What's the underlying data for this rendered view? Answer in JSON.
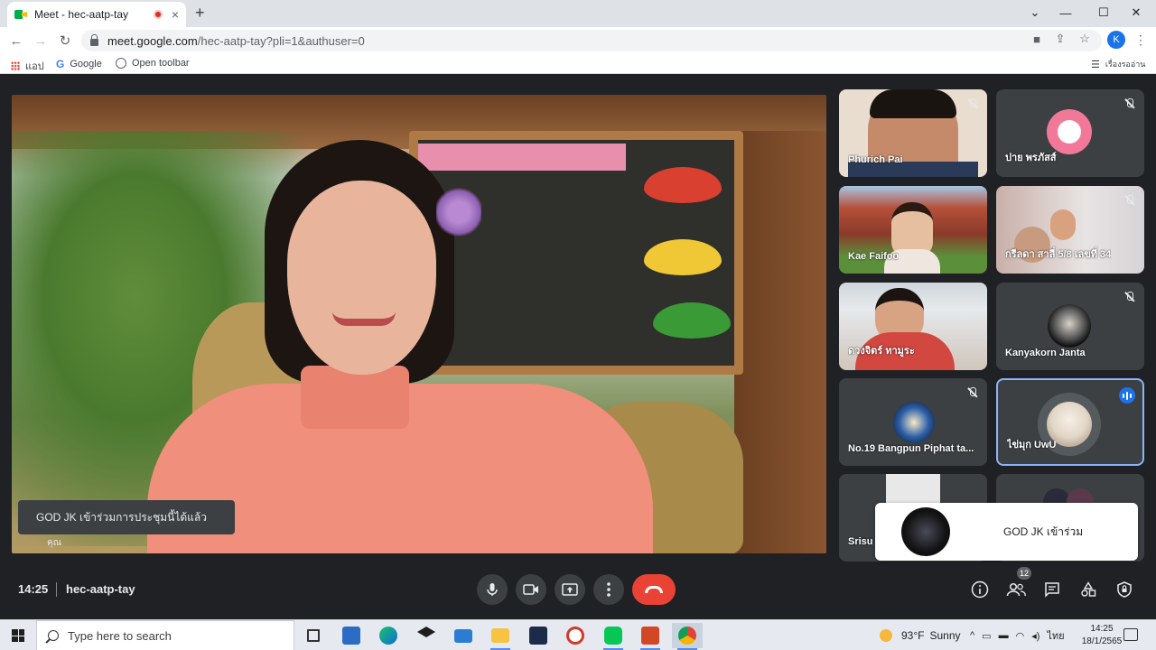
{
  "browser": {
    "tab_title": "Meet - hec-aatp-tay",
    "tab_close": "×",
    "new_tab": "+",
    "window_controls": [
      "⌄",
      "—",
      "☐",
      "✕"
    ],
    "nav": {
      "back": "←",
      "forward": "→",
      "reload": "↻"
    },
    "url_host": "meet.google.com",
    "url_path": "/hec-aatp-tay?pli=1&authuser=0",
    "profile_initial": "K",
    "menu_icon": "⋮",
    "bookmarks": {
      "apps_label": "แอป",
      "google_label": "Google",
      "toolbar_label": "Open toolbar",
      "reading_list_label": "เรื่องรออ่าน"
    }
  },
  "meet": {
    "join_toast": "GOD JK เข้าร่วมการประชุมนี้ได้แล้ว",
    "self_name": "คุณ",
    "participants": [
      {
        "name": "Phurich Pai",
        "muted": true
      },
      {
        "name": "ปาย พรภัสส์",
        "muted": true
      },
      {
        "name": "Kae Faifoo",
        "muted": false
      },
      {
        "name": "กรีลดา สาลี่ 5/8 เลขที่ 34",
        "muted": true
      },
      {
        "name": "ดวงจิตร์ ทามูระ",
        "muted": false
      },
      {
        "name": "Kanyakorn Janta",
        "muted": true
      },
      {
        "name": "No.19 Bangpun Piphat ta...",
        "muted": true
      },
      {
        "name": "ไข่มุก UwU",
        "muted": false,
        "speaking": true
      },
      {
        "name": "Srisu",
        "muted": false
      }
    ],
    "join_card_text": "GOD JK เข้าร่วม",
    "bar": {
      "time": "14:25",
      "meeting_code": "hec-aatp-tay",
      "people_count": "12"
    }
  },
  "taskbar": {
    "search_placeholder": "Type here to search",
    "weather_temp": "93°F",
    "weather_text": "Sunny",
    "language": "ไทย",
    "time": "14:25",
    "date": "18/1/2565"
  },
  "colors": {
    "meet_bg": "#202124",
    "tile_bg": "#3c4043",
    "hangup": "#ea4335",
    "accent": "#1a73e8"
  }
}
